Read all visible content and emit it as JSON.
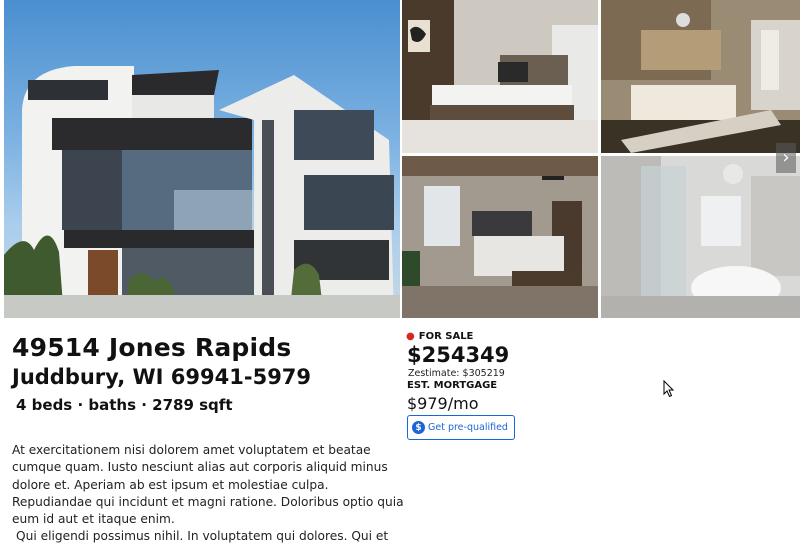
{
  "listing": {
    "address_line1": "49514 Jones Rapids",
    "address_line2": "Juddbury, WI 69941-5979",
    "facts": "4 beds · baths · 2789 sqft",
    "description": [
      "At exercitationem nisi dolorem amet voluptatem et beatae cumque quam. Iusto nesciunt alias aut corporis aliquid minus dolore et. Aperiam ab est ipsum et molestiae culpa. Repudiandae qui incidunt et magni ratione. Doloribus optio quia eum id aut et itaque enim.",
      "Qui eligendi possimus nihil. In voluptatem qui dolores. Qui et"
    ]
  },
  "pricing": {
    "status": "FOR SALE",
    "price": "$254349",
    "zestimate": "Zestimate: $305219",
    "mortgage_label": "EST. MORTGAGE",
    "mortgage": "$979/mo",
    "prequal_button": "Get pre-qualified",
    "status_color": "#d42a1f",
    "accent_color": "#1a66d6"
  },
  "gallery": {
    "photos": [
      "house-exterior",
      "bedroom-1",
      "bedroom-2",
      "bedroom-3",
      "bathroom"
    ],
    "next_icon": "chevron-right-icon",
    "next_glyph": "›"
  }
}
